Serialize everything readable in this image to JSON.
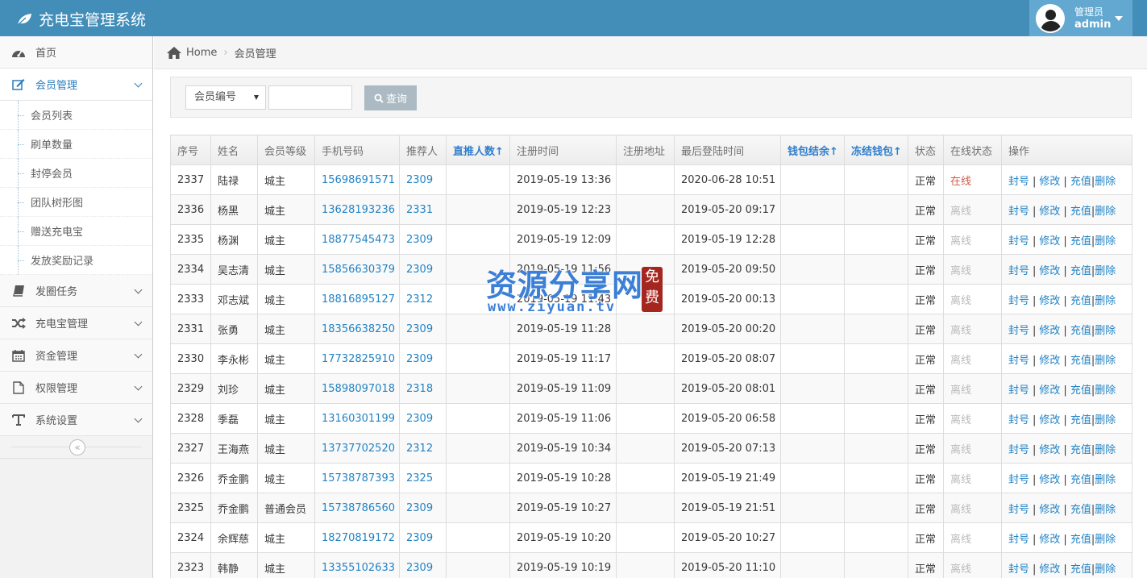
{
  "app": {
    "title": "充电宝管理系统"
  },
  "user": {
    "role": "管理员",
    "name": "admin"
  },
  "sidebar": {
    "items": [
      {
        "label": "首页",
        "icon": "dashboard-icon"
      },
      {
        "label": "会员管理",
        "icon": "edit-icon"
      },
      {
        "label": "发圈任务",
        "icon": "book-icon"
      },
      {
        "label": "充电宝管理",
        "icon": "shuffle-icon"
      },
      {
        "label": "资金管理",
        "icon": "calendar-icon"
      },
      {
        "label": "权限管理",
        "icon": "file-icon"
      },
      {
        "label": "系统设置",
        "icon": "text-icon"
      }
    ],
    "sub_items": [
      "会员列表",
      "刷单数量",
      "封停会员",
      "团队树形图",
      "赠送充电宝",
      "发放奖励记录"
    ],
    "collapse_glyph": "«"
  },
  "breadcrumb": {
    "home": "Home",
    "current": "会员管理"
  },
  "search": {
    "field_select": "会员编号",
    "button": "查询",
    "input_value": ""
  },
  "table": {
    "headers": [
      "序号",
      "姓名",
      "会员等级",
      "手机号码",
      "推荐人",
      "直推人数↑",
      "注册时间",
      "注册地址",
      "最后登陆时间",
      "钱包结余↑",
      "冻结钱包↑",
      "状态",
      "在线状态",
      "操作"
    ],
    "ops": {
      "ban": "封号",
      "edit": "修改",
      "recharge": "充值",
      "delete": "删除",
      "sep": "|"
    },
    "rows": [
      {
        "id": "2337",
        "name": "陆禄",
        "level": "城主",
        "phone": "15698691571",
        "ref": "2309",
        "direct": "",
        "reg": "2019-05-19 13:36",
        "addr": "",
        "last": "2020-06-28 10:51",
        "wallet": "",
        "frozen": "",
        "status": "正常",
        "online": "在线"
      },
      {
        "id": "2336",
        "name": "杨黑",
        "level": "城主",
        "phone": "13628193236",
        "ref": "2331",
        "direct": "",
        "reg": "2019-05-19 12:23",
        "addr": "",
        "last": "2019-05-20 09:17",
        "wallet": "",
        "frozen": "",
        "status": "正常",
        "online": "离线"
      },
      {
        "id": "2335",
        "name": "杨渊",
        "level": "城主",
        "phone": "18877545473",
        "ref": "2309",
        "direct": "",
        "reg": "2019-05-19 12:09",
        "addr": "",
        "last": "2019-05-19 12:28",
        "wallet": "",
        "frozen": "",
        "status": "正常",
        "online": "离线"
      },
      {
        "id": "2334",
        "name": "吴志清",
        "level": "城主",
        "phone": "15856630379",
        "ref": "2309",
        "direct": "",
        "reg": "2019-05-19 11:56",
        "addr": "",
        "last": "2019-05-20 09:50",
        "wallet": "",
        "frozen": "",
        "status": "正常",
        "online": "离线"
      },
      {
        "id": "2333",
        "name": "邓志斌",
        "level": "城主",
        "phone": "18816895127",
        "ref": "2312",
        "direct": "",
        "reg": "2019-05-19 11:43",
        "addr": "",
        "last": "2019-05-20 00:13",
        "wallet": "",
        "frozen": "",
        "status": "正常",
        "online": "离线"
      },
      {
        "id": "2331",
        "name": "张勇",
        "level": "城主",
        "phone": "18356638250",
        "ref": "2309",
        "direct": "",
        "reg": "2019-05-19 11:28",
        "addr": "",
        "last": "2019-05-20 00:20",
        "wallet": "",
        "frozen": "",
        "status": "正常",
        "online": "离线"
      },
      {
        "id": "2330",
        "name": "李永彬",
        "level": "城主",
        "phone": "17732825910",
        "ref": "2309",
        "direct": "",
        "reg": "2019-05-19 11:17",
        "addr": "",
        "last": "2019-05-20 08:07",
        "wallet": "",
        "frozen": "",
        "status": "正常",
        "online": "离线"
      },
      {
        "id": "2329",
        "name": "刘珍",
        "level": "城主",
        "phone": "15898097018",
        "ref": "2318",
        "direct": "",
        "reg": "2019-05-19 11:09",
        "addr": "",
        "last": "2019-05-20 08:01",
        "wallet": "",
        "frozen": "",
        "status": "正常",
        "online": "离线"
      },
      {
        "id": "2328",
        "name": "季磊",
        "level": "城主",
        "phone": "13160301199",
        "ref": "2309",
        "direct": "",
        "reg": "2019-05-19 11:06",
        "addr": "",
        "last": "2019-05-20 06:58",
        "wallet": "",
        "frozen": "",
        "status": "正常",
        "online": "离线"
      },
      {
        "id": "2327",
        "name": "王海燕",
        "level": "城主",
        "phone": "13737702520",
        "ref": "2312",
        "direct": "",
        "reg": "2019-05-19 10:34",
        "addr": "",
        "last": "2019-05-20 07:13",
        "wallet": "",
        "frozen": "",
        "status": "正常",
        "online": "离线"
      },
      {
        "id": "2326",
        "name": "乔金鹏",
        "level": "城主",
        "phone": "15738787393",
        "ref": "2325",
        "direct": "",
        "reg": "2019-05-19 10:28",
        "addr": "",
        "last": "2019-05-19 21:49",
        "wallet": "",
        "frozen": "",
        "status": "正常",
        "online": "离线"
      },
      {
        "id": "2325",
        "name": "乔金鹏",
        "level": "普通会员",
        "phone": "15738786560",
        "ref": "2309",
        "direct": "",
        "reg": "2019-05-19 10:27",
        "addr": "",
        "last": "2019-05-19 21:51",
        "wallet": "",
        "frozen": "",
        "status": "正常",
        "online": "离线"
      },
      {
        "id": "2324",
        "name": "余辉慈",
        "level": "城主",
        "phone": "18270819172",
        "ref": "2309",
        "direct": "",
        "reg": "2019-05-19 10:20",
        "addr": "",
        "last": "2019-05-20 10:27",
        "wallet": "",
        "frozen": "",
        "status": "正常",
        "online": "离线"
      },
      {
        "id": "2323",
        "name": "韩静",
        "level": "城主",
        "phone": "13355102633",
        "ref": "2309",
        "direct": "",
        "reg": "2019-05-19 10:19",
        "addr": "",
        "last": "2019-05-20 11:10",
        "wallet": "",
        "frozen": "",
        "status": "正常",
        "online": "离线"
      }
    ]
  },
  "watermark": {
    "text": "资源分享网",
    "url": "www.ziyuan.tv",
    "seal": "免费"
  },
  "colors": {
    "header": "#438eb9",
    "link": "#2283c5",
    "online": "#d15b47",
    "offline": "#bbbbbb"
  }
}
